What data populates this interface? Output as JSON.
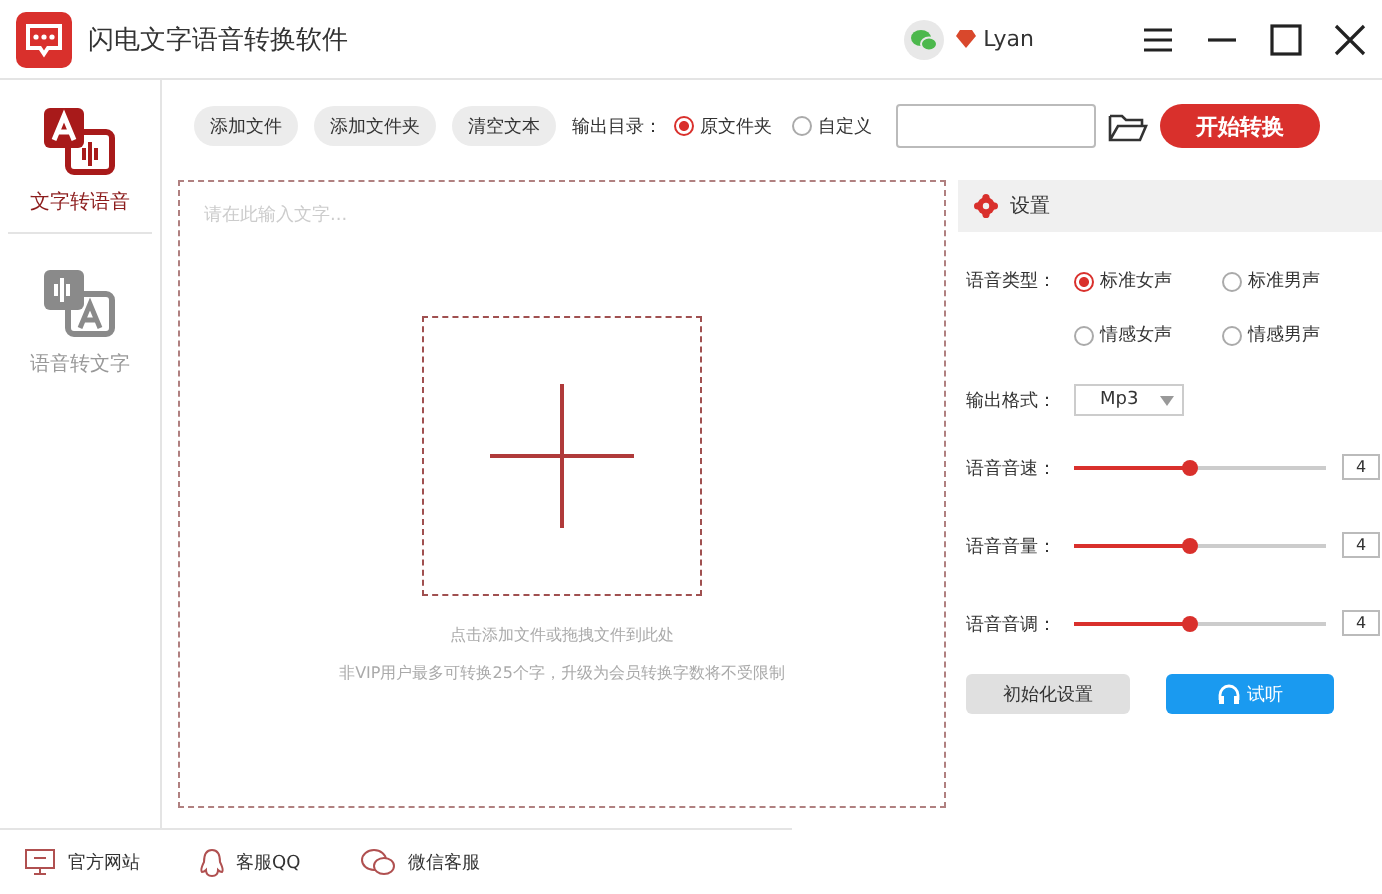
{
  "window": {
    "title": "闪电文字语音转换软件",
    "user": "Lyan"
  },
  "sidebar": {
    "items": [
      {
        "label": "文字转语音",
        "kind": "text-to-speech",
        "selected": true
      },
      {
        "label": "语音转文字",
        "kind": "speech-to-text",
        "selected": false
      }
    ]
  },
  "toolbar": {
    "buttons": [
      "添加文件",
      "添加文件夹",
      "清空文本"
    ],
    "output_label": "输出目录：",
    "output_options": [
      {
        "label": "原文件夹",
        "selected": true
      },
      {
        "label": "自定义",
        "selected": false
      }
    ],
    "start_button": "开始转换"
  },
  "editor": {
    "placeholder": "请在此输入文字...",
    "hints": [
      "点击添加文件或拖拽文件到此处",
      "非VIP用户最多可转换25个字，升级为会员转换字数将不受限制"
    ]
  },
  "settings": {
    "title": "设置",
    "voice_label": "语音类型：",
    "voices": [
      {
        "label": "标准女声",
        "selected": true
      },
      {
        "label": "标准男声",
        "selected": false
      },
      {
        "label": "情感女声",
        "selected": false
      },
      {
        "label": "情感男声",
        "selected": false
      }
    ],
    "format_label": "输出格式：",
    "format_value": "Mp3",
    "sliders": [
      {
        "label": "语音音速：",
        "level": 0.46,
        "reading": "4"
      },
      {
        "label": "语音音量：",
        "level": 0.46,
        "reading": "4"
      },
      {
        "label": "语音音调：",
        "level": 0.46,
        "reading": "4"
      }
    ],
    "reset_button": "初始化设置",
    "listen_button": "试听"
  },
  "footer": {
    "links": [
      {
        "label": "官方网站",
        "kind": "website"
      },
      {
        "label": "客服QQ",
        "kind": "qq"
      },
      {
        "label": "微信客服",
        "kind": "wechat"
      }
    ]
  }
}
